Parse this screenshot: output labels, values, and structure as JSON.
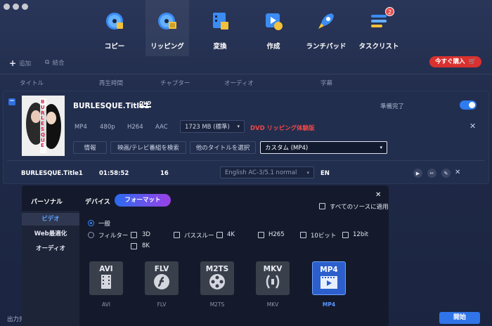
{
  "nav": [
    {
      "label": "コピー",
      "icon": "disc-copy-icon"
    },
    {
      "label": "リッピング",
      "icon": "disc-rip-icon"
    },
    {
      "label": "変換",
      "icon": "film-convert-icon"
    },
    {
      "label": "作成",
      "icon": "video-create-icon"
    },
    {
      "label": "ランチパッド",
      "icon": "rocket-icon"
    },
    {
      "label": "タスクリスト",
      "icon": "task-list-icon",
      "badge": "2"
    }
  ],
  "toolbar": {
    "add": "追加",
    "merge": "結合",
    "buy": "今すぐ購入"
  },
  "columns": {
    "title": "タイトル",
    "duration": "再生時間",
    "chapter": "チャプター",
    "audio": "オーディオ",
    "subtitle": "字幕"
  },
  "item": {
    "title": "BURLESQUE.Title1",
    "dvd_tag": "DVD",
    "status": "準備完了",
    "format": "MP4",
    "resolution": "480p",
    "codec": "H264",
    "audio_codec": "AAC",
    "size": "1723 MB (標準)",
    "ripping_label": "DVD リッピング",
    "trial_label": "体験版",
    "info_btn": "情報",
    "search_btn": "映画/テレビ番組を検索",
    "other_title_btn": "他のタイトルを選択",
    "profile": "カスタム (MP4)",
    "poster_text": "BURLESQUE"
  },
  "track": {
    "name": "BURLESQUE.Title1",
    "duration": "01:58:52",
    "chapters": "16",
    "audio": "English AC-3/5.1 normal",
    "subtitle": "EN"
  },
  "popup": {
    "side": [
      "パーソナル",
      "ビデオ",
      "Web最適化",
      "オーディオ"
    ],
    "tab_device": "デバイス",
    "tab_format": "フォーマット",
    "apply_all": "すべてのソースに適用",
    "radio_general": "一般",
    "radio_filter": "フィルター",
    "filters": [
      "3D",
      "パススルー",
      "4K",
      "H265",
      "10ビット",
      "12bit",
      "8K"
    ],
    "formats": [
      {
        "name": "AVI",
        "label": "AVI"
      },
      {
        "name": "FLV",
        "label": "FLV"
      },
      {
        "name": "M2TS",
        "label": "M2TS"
      },
      {
        "name": "MKV",
        "label": "MKV"
      },
      {
        "name": "MP4",
        "label": "MP4"
      }
    ]
  },
  "footer": {
    "output": "出力先",
    "start": "開始"
  },
  "colors": {
    "accent": "#2f74e8",
    "buy": "#d9312f",
    "warning": "#f04747"
  }
}
